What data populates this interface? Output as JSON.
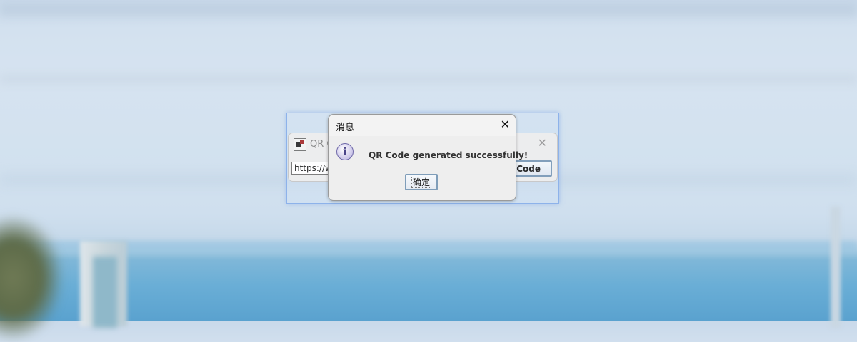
{
  "parent_window": {
    "title": "QR C",
    "url_value": "https://ww",
    "generate_button_label": "R Code",
    "close_glyph": "✕"
  },
  "dialog": {
    "title": "消息",
    "message": "QR Code generated successfully!",
    "ok_label": "确定",
    "close_glyph": "✕",
    "icon": "info-icon"
  },
  "colors": {
    "dialog_bg": "#eeeeee",
    "focus_border": "#7f9db9",
    "selection_glow": "#8db2ea"
  }
}
